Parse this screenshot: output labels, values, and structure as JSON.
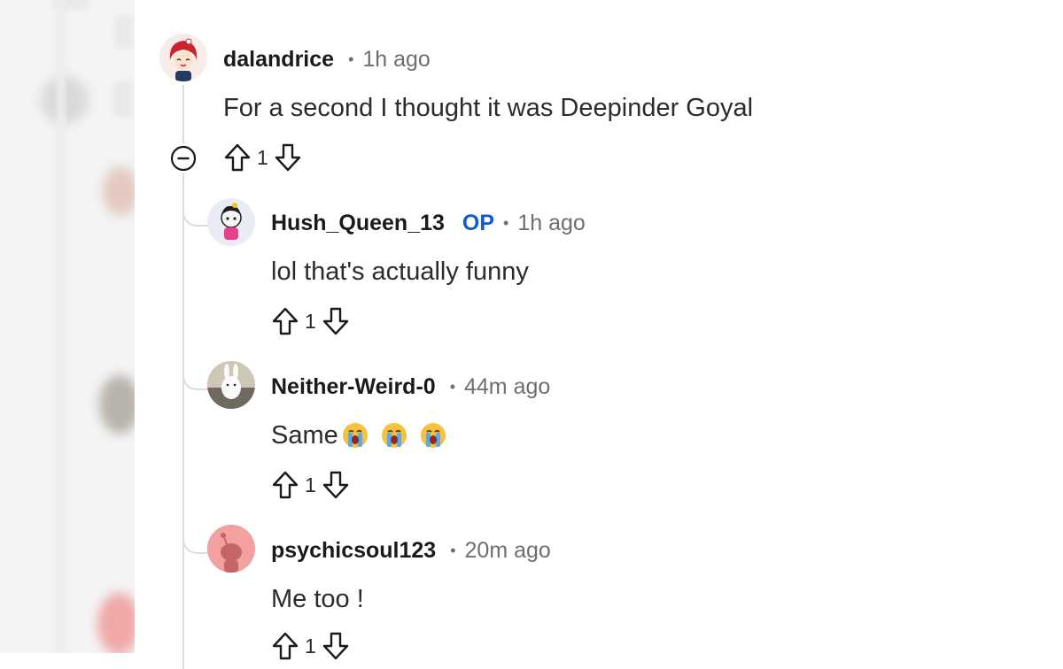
{
  "thread": {
    "parent": {
      "author": "dalandrice",
      "time": "1h ago",
      "body": "For a second I thought it was Deepinder Goyal",
      "score": "1"
    },
    "replies": [
      {
        "author": "Hush_Queen_13",
        "badge": "OP",
        "time": "1h ago",
        "body": "lol that's actually funny",
        "score": "1"
      },
      {
        "author": "Neither-Weird-0",
        "time": "44m ago",
        "body": "Same",
        "emoji": [
          "loudly-crying-face",
          "loudly-crying-face",
          "loudly-crying-face"
        ],
        "score": "1"
      },
      {
        "author": "psychicsoul123",
        "time": "20m ago",
        "body": "Me too !",
        "score": "1"
      }
    ],
    "separator": "•"
  },
  "colors": {
    "op_badge": "#0f5bd4",
    "meta_gray": "#6b6f72",
    "thread_line": "#dcdcdc"
  }
}
